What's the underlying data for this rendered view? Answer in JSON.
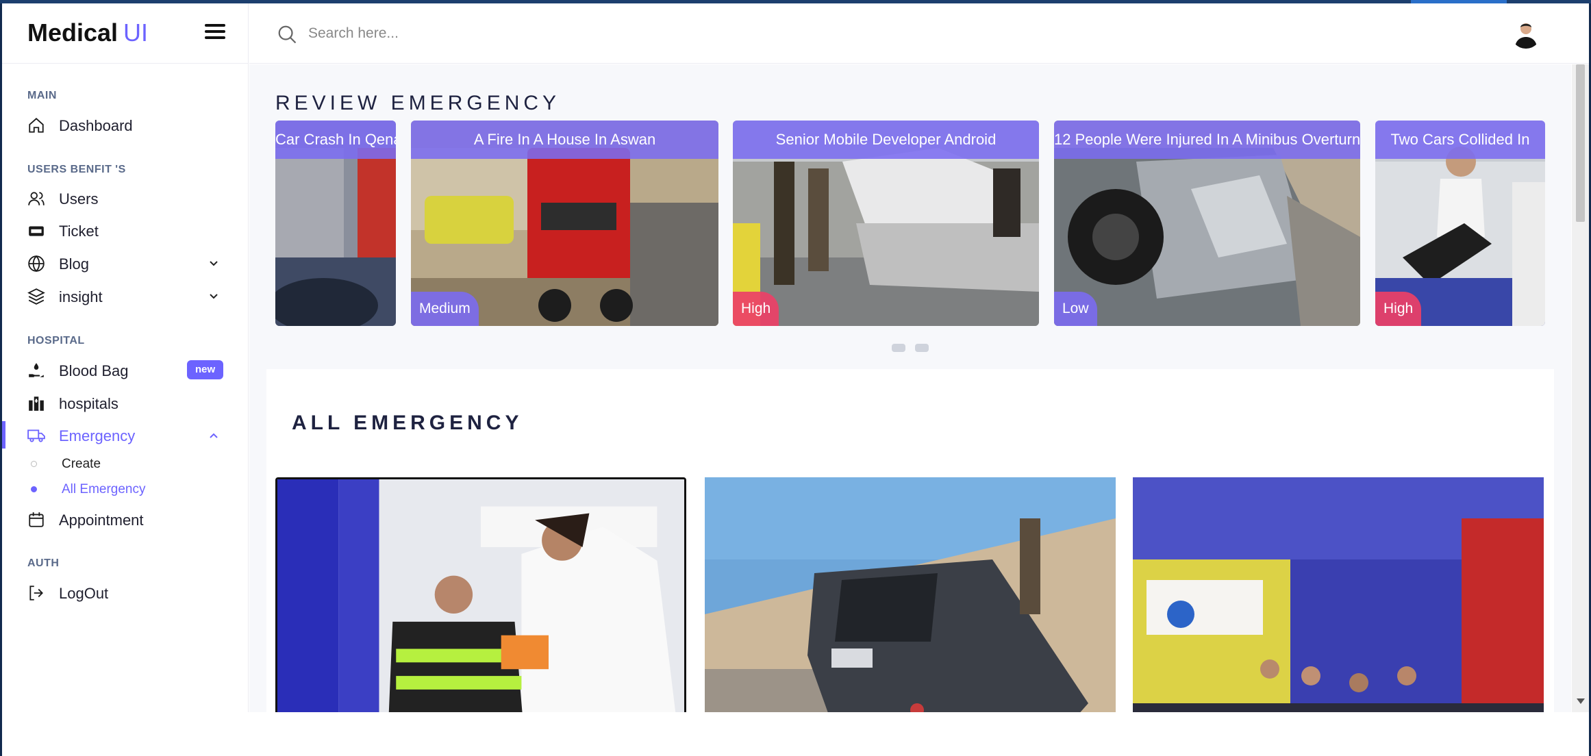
{
  "brand": {
    "name": "Medical",
    "suffix": "UI"
  },
  "search": {
    "placeholder": "Search here..."
  },
  "sidebar": {
    "sections": {
      "main": "MAIN",
      "users": "USERS BENFIT 'S",
      "hospital": "HOSPITAL",
      "auth": "AUTH"
    },
    "items": {
      "dashboard": "Dashboard",
      "users": "Users",
      "ticket": "Ticket",
      "blog": "Blog",
      "insight": "insight",
      "blood_bag": "Blood Bag",
      "blood_bag_badge": "new",
      "hospitals": "hospitals",
      "emergency": "Emergency",
      "create": "Create",
      "all_emergency": "All Emergency",
      "appointment": "Appointment",
      "logout": "LogOut"
    }
  },
  "review": {
    "title": "REVIEW EMERGENCY",
    "slides": [
      {
        "caption": "Car Crash In Qena",
        "level": ""
      },
      {
        "caption": "A Fire In A House In Aswan",
        "level": "Medium"
      },
      {
        "caption": "Senior Mobile Developer Android",
        "level": "High"
      },
      {
        "caption": "12 People Were Injured In A Minibus Overturn",
        "level": "Low"
      },
      {
        "caption": "Two Cars Collided In",
        "level": "High"
      }
    ]
  },
  "all": {
    "title": "ALL EMERGENCY"
  },
  "colors": {
    "accent": "#6c63ff",
    "high": "#ec4067",
    "frame": "#122a4e"
  },
  "icons": {
    "dashboard": "home-icon",
    "users": "users-icon",
    "ticket": "ticket-icon",
    "blog": "globe-icon",
    "insight": "layers-icon",
    "blood_bag": "hand-drop-icon",
    "hospitals": "building-icon",
    "emergency": "truck-icon",
    "appointment": "calendar-icon",
    "logout": "logout-icon"
  }
}
